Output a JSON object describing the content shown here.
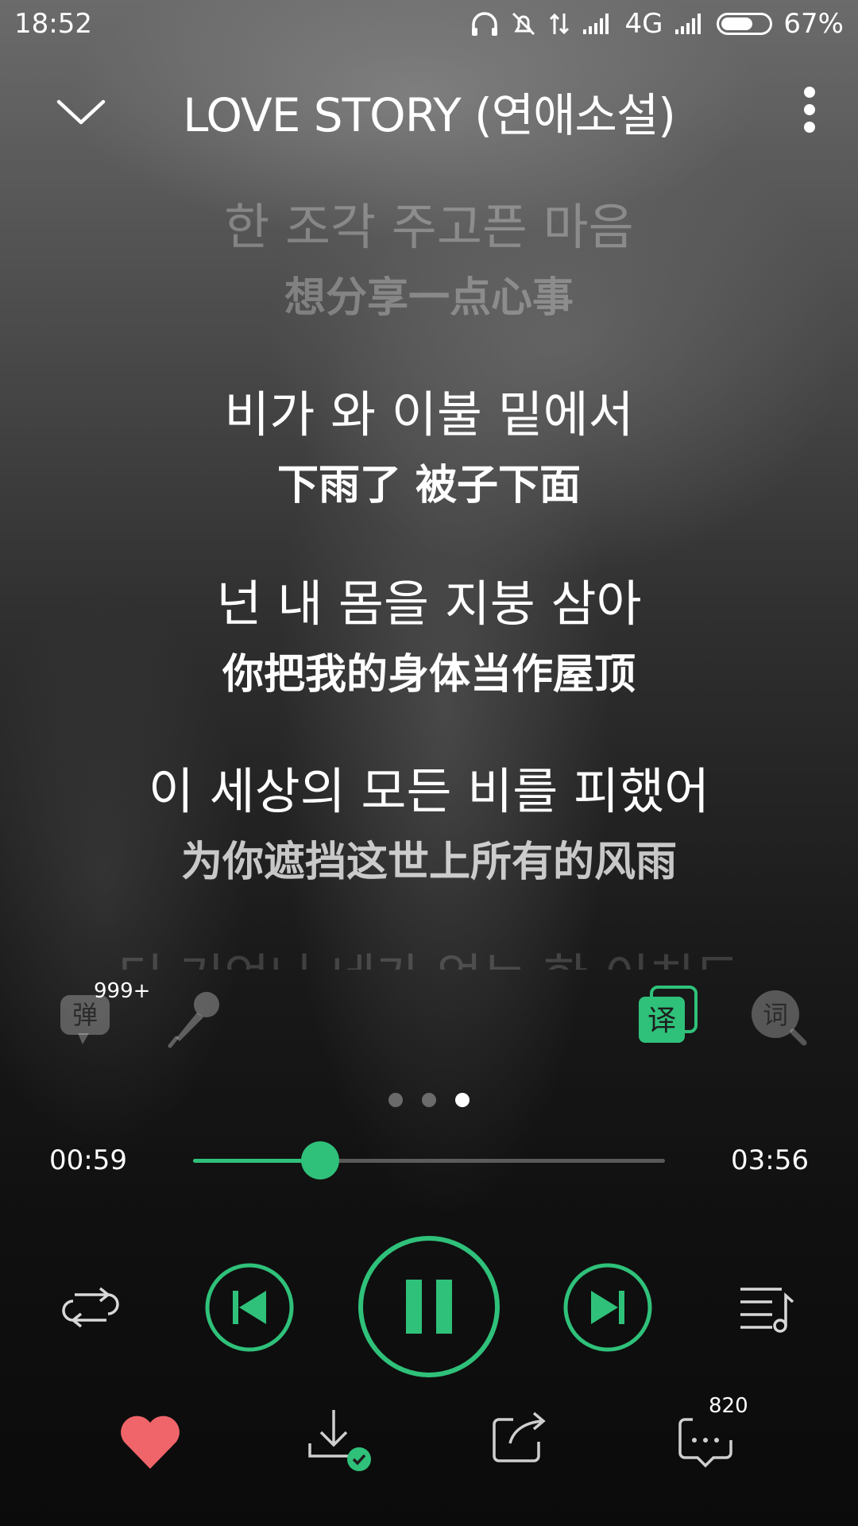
{
  "status_bar": {
    "time": "18:52",
    "network": "4G",
    "battery": "67%",
    "battery_level": 0.67
  },
  "header": {
    "title": "LOVE STORY (연애소설)"
  },
  "lyrics": [
    {
      "kr": "한 조각 주고픈 마음",
      "cn": "想分享一点心事"
    },
    {
      "kr": "비가 와 이불 밑에서",
      "cn": "下雨了 被子下面"
    },
    {
      "kr": "넌 내 몸을 지붕 삼아",
      "cn": "你把我的身体当作屋顶"
    },
    {
      "kr": "이 세상의 모든 비를 피했어",
      "cn": "为你遮挡这世上所有的风雨"
    }
  ],
  "next_line_faded": "더 기억나 네가 없는 한 이치도",
  "tools": {
    "danmu_label": "弹",
    "danmu_count": "999+",
    "translate_label": "译",
    "lyrics_search_label": "词"
  },
  "player": {
    "current_time": "00:59",
    "total_time": "03:56",
    "progress": 0.27,
    "active_page": 2,
    "page_count": 3
  },
  "actions": {
    "comment_count": "820"
  },
  "colors": {
    "accent": "#2fc17a",
    "heart": "#f0656a"
  }
}
